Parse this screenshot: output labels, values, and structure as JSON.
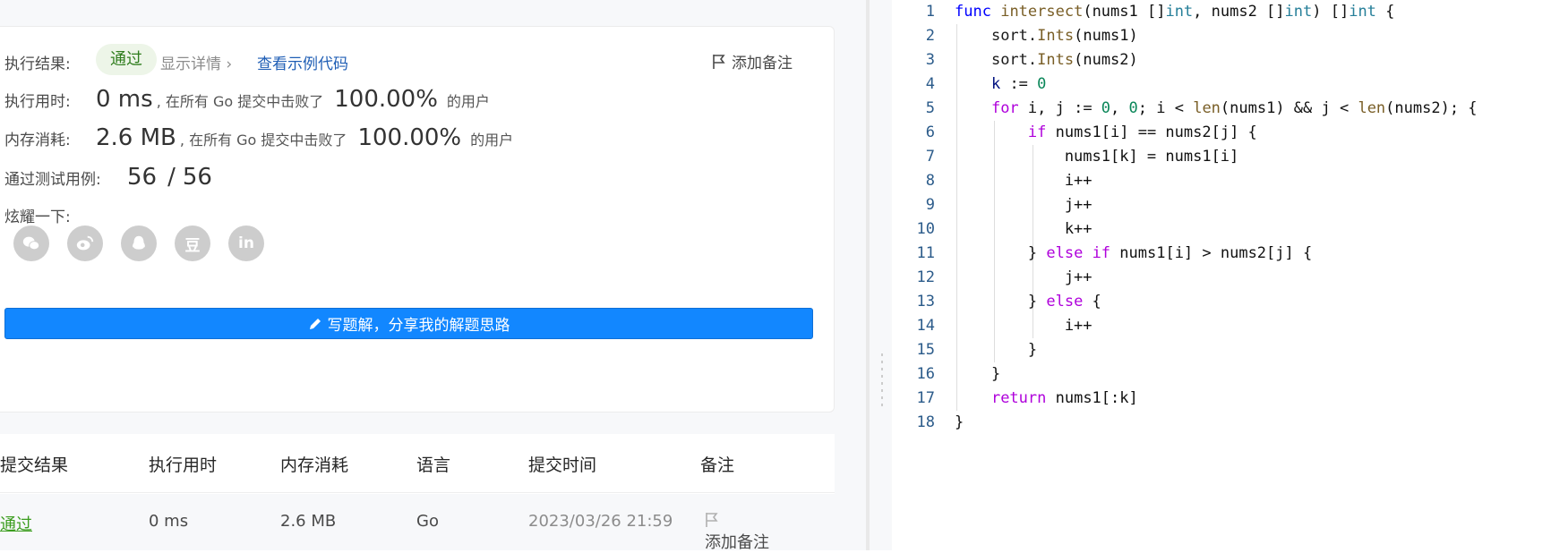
{
  "result": {
    "label": "执行结果:",
    "status": "通过",
    "details_link": "显示详情 ›",
    "sample_code_link": "查看示例代码",
    "add_note": "添加备注"
  },
  "runtime": {
    "label": "执行用时:",
    "value": "0 ms",
    "mid_text": ", 在所有 Go 提交中击败了",
    "percent": "100.00%",
    "suffix": "的用户"
  },
  "memory": {
    "label": "内存消耗:",
    "value": "2.6 MB",
    "mid_text": ", 在所有 Go 提交中击败了",
    "percent": "100.00%",
    "suffix": "的用户"
  },
  "testcases": {
    "label": "通过测试用例:",
    "passed": "56",
    "sep": "/",
    "total": "56"
  },
  "share": {
    "label": "炫耀一下:",
    "icons": [
      "wechat-icon",
      "weibo-icon",
      "qq-icon",
      "douban-icon",
      "linkedin-icon"
    ],
    "douban_glyph": "豆",
    "linkedin_glyph": "in"
  },
  "write_solution_button": "写题解，分享我的解题思路",
  "submissions": {
    "headers": [
      "提交结果",
      "执行用时",
      "内存消耗",
      "语言",
      "提交时间",
      "备注"
    ],
    "rows": [
      {
        "result": "通过",
        "runtime": "0 ms",
        "memory": "2.6 MB",
        "language": "Go",
        "time": "2023/03/26 21:59",
        "note": "添加备注"
      }
    ]
  },
  "editor": {
    "line_numbers": [
      "1",
      "2",
      "3",
      "4",
      "5",
      "6",
      "7",
      "8",
      "9",
      "10",
      "11",
      "12",
      "13",
      "14",
      "15",
      "16",
      "17",
      "18"
    ],
    "colors": {
      "keyword": "#0000ff",
      "control": "#af00db",
      "function": "#795e26",
      "type": "#267f99",
      "number": "#098658"
    }
  }
}
